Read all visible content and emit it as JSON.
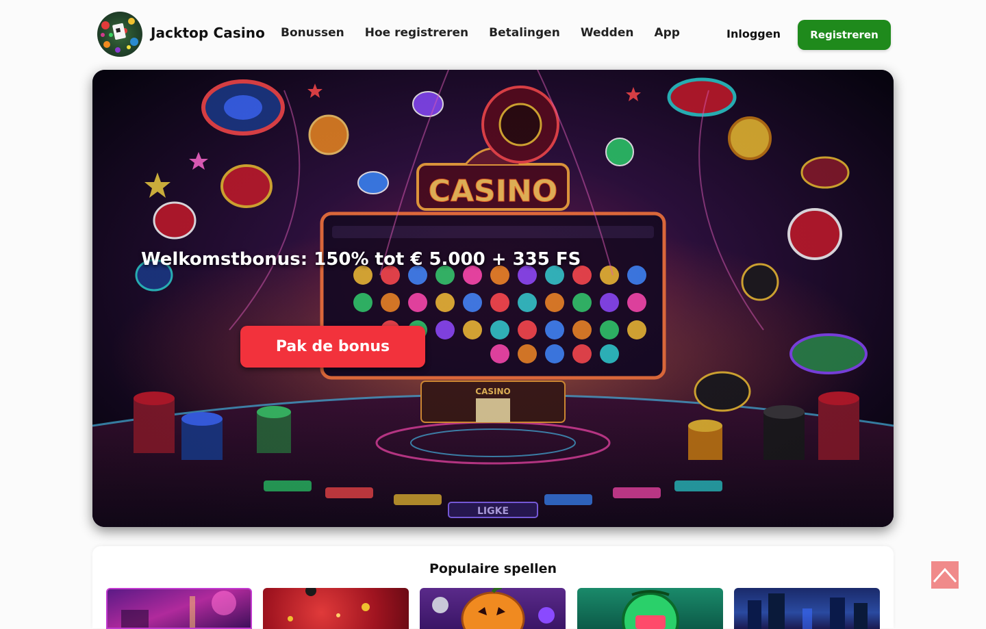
{
  "header": {
    "brand": "Jacktop Casino",
    "logo_icon": "casino-logo-icon",
    "nav": [
      {
        "label": "Bonussen"
      },
      {
        "label": "Hoe registreren"
      },
      {
        "label": "Betalingen"
      },
      {
        "label": "Wedden"
      },
      {
        "label": "App"
      }
    ],
    "login_label": "Inloggen",
    "register_label": "Registreren",
    "register_color": "#1f8a1c"
  },
  "hero": {
    "title": "Welkomstbonus: 150% tot € 5.000 + 335 FS",
    "button_label": "Pak de bonus",
    "button_color": "#f2323c",
    "sign_text": "CASINO",
    "floor_text": "LIGKE",
    "mini_sign": "CASINO"
  },
  "games": {
    "title": "Populaire spellen"
  },
  "scroll_top": {
    "icon": "chevron-up-icon",
    "color": "#f08a8a"
  }
}
